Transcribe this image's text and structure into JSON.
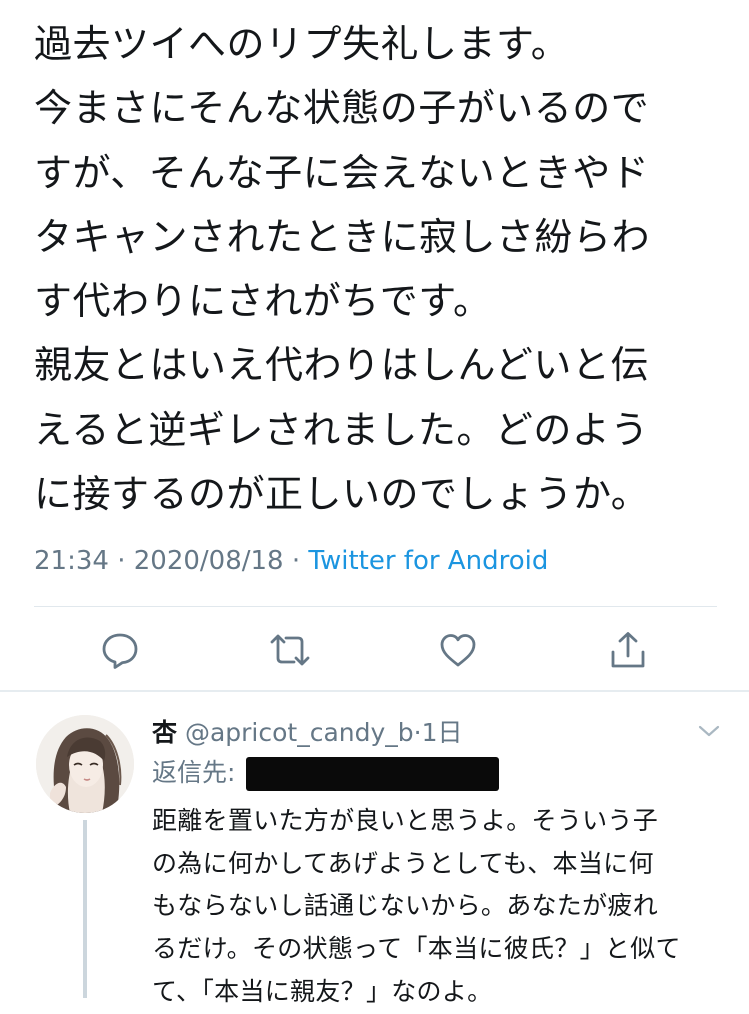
{
  "tweet": {
    "lines": [
      "過去ツイへのリプ失礼します。",
      "今まさにそんな状態の子がいるので",
      "すが、そんな子に会えないときやド",
      "タキャンされたときに寂しさ紛らわ",
      "す代わりにされがちです。",
      "親友とはいえ代わりはしんどいと伝",
      "えると逆ギレされました。どのよう",
      "に接するのが正しいのでしょうか。"
    ],
    "time": "21:34",
    "sep1": " · ",
    "date": "2020/08/18",
    "sep2": " · ",
    "source": "Twitter for Android"
  },
  "actions": {
    "reply_icon": "comment-icon",
    "retweet_icon": "retweet-icon",
    "like_icon": "heart-icon",
    "share_icon": "share-icon"
  },
  "reply": {
    "name": "杏",
    "handle": " @apricot_candy_b",
    "dot": "·",
    "time": "1日",
    "reply_to_label": "返信先:",
    "lines": [
      "距離を置いた方が良いと思うよ。そういう子",
      "の為に何かしてあげようとしても、本当に何",
      "もならないし話通じないから。あなたが疲れ",
      "るだけ。その状態って「本当に彼氏？」と似て",
      "て、「本当に親友？」なのよ。"
    ]
  },
  "colors": {
    "text": "#14171a",
    "secondary": "#657786",
    "link": "#1b95e0",
    "icon": "#657786",
    "divider": "#e1e8ed"
  }
}
